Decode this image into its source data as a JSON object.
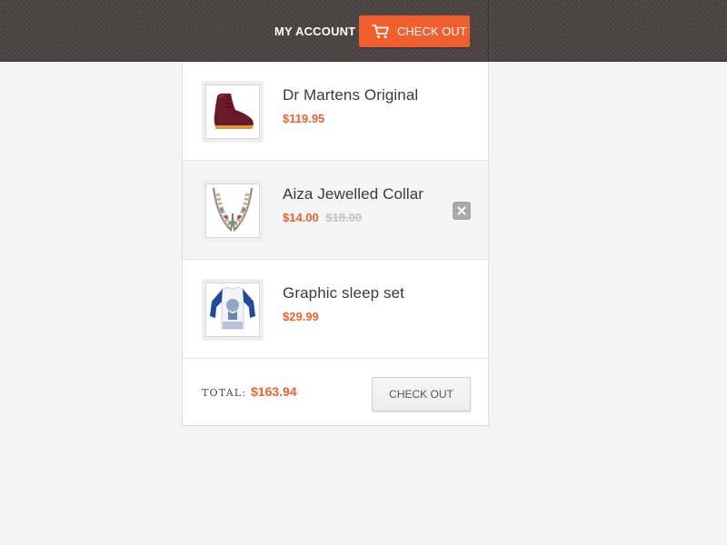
{
  "header": {
    "my_account_label": "MY ACCOUNT",
    "checkout_label": "CHECK OUT",
    "cart_icon": "shopping-cart-icon"
  },
  "cart": {
    "items": [
      {
        "name": "Dr Martens Original",
        "price": "$119.95",
        "old_price": "",
        "thumbnail_icon": "boot-icon"
      },
      {
        "name": "Aiza Jewelled Collar",
        "price": "$14.00",
        "old_price": "$18.00",
        "thumbnail_icon": "necklace-icon",
        "remove_icon": "close-icon"
      },
      {
        "name": "Graphic sleep set",
        "price": "$29.99",
        "old_price": "",
        "thumbnail_icon": "shirt-icon"
      }
    ],
    "total_label": "TOTAL:",
    "total_value": "$163.94",
    "checkout_label": "CHECK OUT"
  },
  "colors": {
    "accent": "#f25f2f",
    "header_bg": "#4a4341",
    "page_bg": "#f4f4f4"
  }
}
